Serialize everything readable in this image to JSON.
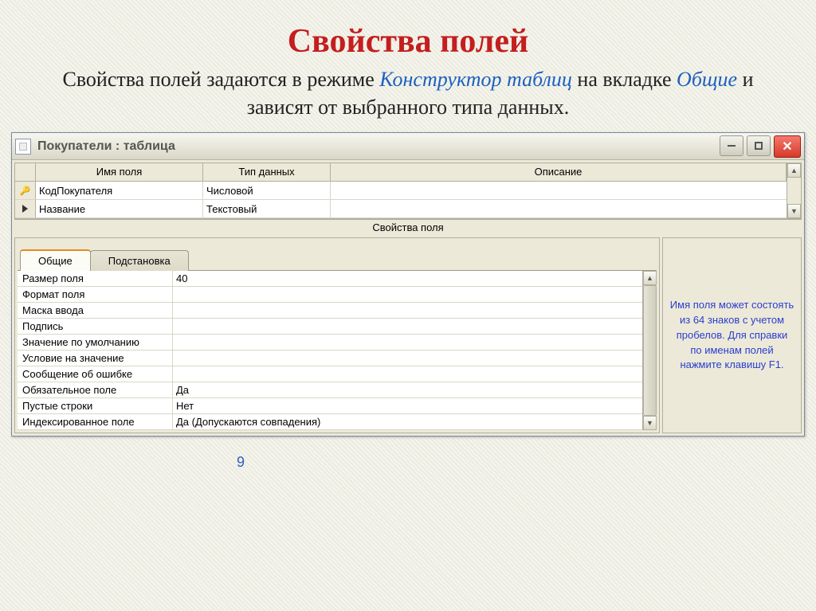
{
  "slide": {
    "title": "Свойства полей",
    "subtitle_1": "Свойства полей задаются в режиме ",
    "subtitle_em1": "Конструктор таблиц",
    "subtitle_2": " на вкладке ",
    "subtitle_em2": "Общие",
    "subtitle_3": " и зависят от выбранного типа данных.",
    "page_number": "9"
  },
  "window": {
    "title": "Покупатели : таблица"
  },
  "grid": {
    "headers": {
      "name": "Имя поля",
      "type": "Тип данных",
      "desc": "Описание"
    },
    "rows": [
      {
        "marker": "key",
        "name": "КодПокупателя",
        "type": "Числовой",
        "desc": ""
      },
      {
        "marker": "arrow",
        "name": "Название",
        "type": "Текстовый",
        "desc": ""
      }
    ]
  },
  "section_label": "Свойства поля",
  "tabs": {
    "active": "Общие",
    "inactive": "Подстановка"
  },
  "properties": [
    {
      "label": "Размер поля",
      "value": "40"
    },
    {
      "label": "Формат поля",
      "value": ""
    },
    {
      "label": "Маска ввода",
      "value": ""
    },
    {
      "label": "Подпись",
      "value": ""
    },
    {
      "label": "Значение по умолчанию",
      "value": ""
    },
    {
      "label": "Условие на значение",
      "value": ""
    },
    {
      "label": "Сообщение об ошибке",
      "value": ""
    },
    {
      "label": "Обязательное поле",
      "value": "Да"
    },
    {
      "label": "Пустые строки",
      "value": "Нет"
    },
    {
      "label": "Индексированное поле",
      "value": "Да (Допускаются совпадения)"
    }
  ],
  "hint": "Имя поля может состоять из 64 знаков с учетом пробелов.  Для справки по именам полей нажмите клавишу F1."
}
